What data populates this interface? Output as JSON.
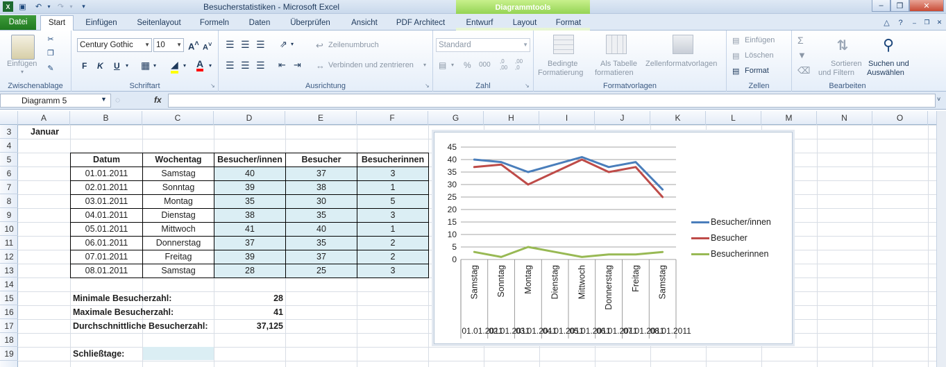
{
  "window": {
    "title": "Besucherstatistiken - Microsoft Excel",
    "contextual_group": "Diagrammtools"
  },
  "tabs": {
    "datei": "Datei",
    "start": "Start",
    "einfuegen": "Einfügen",
    "seitenlayout": "Seitenlayout",
    "formeln": "Formeln",
    "daten": "Daten",
    "ueberpruefen": "Überprüfen",
    "ansicht": "Ansicht",
    "pdf": "PDF Architect",
    "entwurf": "Entwurf",
    "layout": "Layout",
    "format": "Format"
  },
  "ribbon": {
    "clipboard": {
      "paste": "Einfügen",
      "label": "Zwischenablage"
    },
    "font": {
      "name": "Century Gothic",
      "size": "10",
      "label": "Schriftart"
    },
    "alignment": {
      "wrap": "Zeilenumbruch",
      "merge": "Verbinden und zentrieren",
      "label": "Ausrichtung"
    },
    "number": {
      "format": "Standard",
      "label": "Zahl"
    },
    "styles": {
      "conditional_1": "Bedingte",
      "conditional_2": "Formatierung",
      "as_table_1": "Als Tabelle",
      "as_table_2": "formatieren",
      "cell_styles": "Zellenformatvorlagen",
      "label": "Formatvorlagen"
    },
    "cells": {
      "insert": "Einfügen",
      "delete": "Löschen",
      "format": "Format",
      "label": "Zellen"
    },
    "editing": {
      "sort_1": "Sortieren",
      "sort_2": "und Filtern",
      "find_1": "Suchen und",
      "find_2": "Auswählen",
      "label": "Bearbeiten"
    }
  },
  "formula_bar": {
    "name_box": "Diagramm 5",
    "fx": "fx",
    "value": ""
  },
  "columns": [
    "A",
    "B",
    "C",
    "D",
    "E",
    "F",
    "G",
    "H",
    "I",
    "J",
    "K",
    "L",
    "M",
    "N",
    "O"
  ],
  "rows": [
    "3",
    "4",
    "5",
    "6",
    "7",
    "8",
    "9",
    "10",
    "11",
    "12",
    "13",
    "14",
    "15",
    "16",
    "17",
    "18",
    "19"
  ],
  "sheet": {
    "month": "Januar",
    "headers": [
      "Datum",
      "Wochentag",
      "Besucher/innen",
      "Besucher",
      "Besucherinnen"
    ],
    "data": [
      [
        "01.01.2011",
        "Samstag",
        "40",
        "37",
        "3"
      ],
      [
        "02.01.2011",
        "Sonntag",
        "39",
        "38",
        "1"
      ],
      [
        "03.01.2011",
        "Montag",
        "35",
        "30",
        "5"
      ],
      [
        "04.01.2011",
        "Dienstag",
        "38",
        "35",
        "3"
      ],
      [
        "05.01.2011",
        "Mittwoch",
        "41",
        "40",
        "1"
      ],
      [
        "06.01.2011",
        "Donnerstag",
        "37",
        "35",
        "2"
      ],
      [
        "07.01.2011",
        "Freitag",
        "39",
        "37",
        "2"
      ],
      [
        "08.01.2011",
        "Samstag",
        "28",
        "25",
        "3"
      ]
    ],
    "min_label": "Minimale Besucherzahl:",
    "min_value": "28",
    "max_label": "Maximale Besucherzahl:",
    "max_value": "41",
    "avg_label": "Durchschnittliche Besucherzahl:",
    "avg_value": "37,125",
    "closed_label": "Schließtage:"
  },
  "chart_data": {
    "type": "line",
    "categories": [
      "Samstag",
      "Sonntag",
      "Montag",
      "Dienstag",
      "Mittwoch",
      "Donnerstag",
      "Freitag",
      "Samstag"
    ],
    "date_labels": [
      "01.01.2011",
      "02.01.2011",
      "03.01.2011",
      "04.01.2011",
      "05.01.2011",
      "06.01.2011",
      "07.01.2011",
      "08.01.2011"
    ],
    "series": [
      {
        "name": "Besucher/innen",
        "values": [
          40,
          39,
          35,
          38,
          41,
          37,
          39,
          28
        ],
        "color": "#4a7ebb"
      },
      {
        "name": "Besucher",
        "values": [
          37,
          38,
          30,
          35,
          40,
          35,
          37,
          25
        ],
        "color": "#be4b48"
      },
      {
        "name": "Besucherinnen",
        "values": [
          3,
          1,
          5,
          3,
          1,
          2,
          2,
          3
        ],
        "color": "#98b954"
      }
    ],
    "yticks": [
      "0",
      "5",
      "10",
      "15",
      "20",
      "25",
      "30",
      "35",
      "40",
      "45"
    ],
    "ylim": [
      0,
      45
    ],
    "grid": true,
    "legend": "right"
  }
}
